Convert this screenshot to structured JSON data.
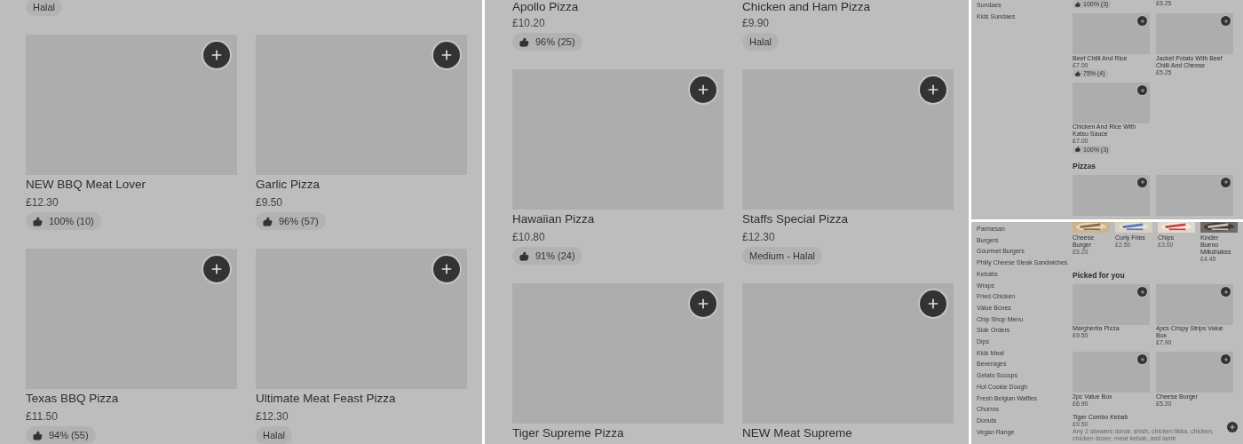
{
  "panels": [
    {
      "kind": "grid",
      "rows": [
        [
          {
            "kind": "tail",
            "badge": {
              "kind": "label",
              "text": "Halal"
            }
          }
        ],
        [
          {
            "kind": "card",
            "title": "NEW BBQ Meat Lover",
            "price": "£12.30",
            "badge": {
              "kind": "rating",
              "text": "100% (10)"
            }
          },
          {
            "kind": "card",
            "title": "Garlic Pizza",
            "price": "£9.50",
            "badge": {
              "kind": "rating",
              "text": "96% (57)"
            }
          }
        ],
        [
          {
            "kind": "card",
            "title": "Texas BBQ Pizza",
            "price": "£11.50",
            "badge": {
              "kind": "rating",
              "text": "94% (55)"
            }
          },
          {
            "kind": "card",
            "title": "Ultimate Meat Feast Pizza",
            "price": "£12.30",
            "badge": {
              "kind": "label",
              "text": "Halal"
            }
          }
        ]
      ]
    },
    {
      "kind": "grid",
      "rows": [
        [
          {
            "kind": "tail",
            "title": "Apollo Pizza",
            "price": "£10.20",
            "badge": {
              "kind": "rating",
              "text": "96% (25)"
            }
          },
          {
            "kind": "tail",
            "title": "Chicken and Ham Pizza",
            "price": "£9.90",
            "badge": {
              "kind": "label",
              "text": "Halal"
            }
          }
        ],
        [
          {
            "kind": "card",
            "title": "Hawaiian Pizza",
            "price": "£10.80",
            "badge": {
              "kind": "rating",
              "text": "91% (24)"
            }
          },
          {
            "kind": "card",
            "title": "Staffs Special Pizza",
            "price": "£12.30",
            "badge": {
              "kind": "label",
              "text": "Medium - Halal"
            }
          }
        ],
        [
          {
            "kind": "card",
            "title": "Tiger Supreme Pizza"
          },
          {
            "kind": "card",
            "title": "NEW Meat Supreme"
          }
        ]
      ]
    },
    {
      "kind": "menu",
      "sidebar": [
        "Sundaes",
        "Kids Sundaes"
      ],
      "sections": [
        {
          "kind": "grid",
          "rows": [
            [
              {
                "kind": "tail",
                "badge": {
                  "kind": "rating",
                  "text": "100% (3)"
                }
              },
              {
                "kind": "tail",
                "price": "£5.25"
              }
            ],
            [
              {
                "kind": "card",
                "title": "Beef Chilli And Rice",
                "price": "£7.00",
                "badge": {
                  "kind": "rating",
                  "text": "75% (4)"
                }
              },
              {
                "kind": "card",
                "title": "Jacket Potato With Beef Chilli And Cheese",
                "price": "£5.25"
              }
            ],
            [
              {
                "kind": "card",
                "title": "Chicken And Rice With Katsu Sauce",
                "price": "£7.00",
                "badge": {
                  "kind": "rating",
                  "text": "100% (3)"
                }
              }
            ]
          ]
        },
        {
          "kind": "grid",
          "heading": "Pizzas",
          "rows": [
            [
              {
                "kind": "card"
              },
              {
                "kind": "card"
              }
            ]
          ]
        }
      ]
    },
    {
      "kind": "menu",
      "sidebar": [
        "Parmesan",
        "Burgers",
        "Gourmet Burgers",
        "Philly Cheese Steak Sandwiches",
        "Kebabs",
        "Wraps",
        "Fried Chicken",
        "Value Boxes",
        "Chip Shop Menu",
        "Side Orders",
        "Dips",
        "Kids Meal",
        "Beverages",
        "Gelato Scoops",
        "Hot Cookie Dough",
        "Fresh Belgian Waffles",
        "Churros",
        "Donuts",
        "Vegan Range"
      ],
      "sections": [
        {
          "kind": "carousel",
          "items": [
            {
              "title": "Cheese Burger",
              "price": "£5.20"
            },
            {
              "title": "Curly Fries",
              "price": "£2.50"
            },
            {
              "title": "Chips",
              "price": "£3.00"
            },
            {
              "title": "Kinder Bueno Milkshakes",
              "price": "£4.45"
            }
          ]
        },
        {
          "kind": "grid",
          "heading": "Picked for you",
          "rows": [
            [
              {
                "kind": "card",
                "title": "Margherita Pizza",
                "price": "£9.50"
              },
              {
                "kind": "card",
                "title": "4pcs Crispy Strips Value Box",
                "price": "£7.90"
              }
            ],
            [
              {
                "kind": "card",
                "title": "2pc Value Box",
                "price": "£6.90"
              },
              {
                "kind": "card",
                "title": "Cheese Burger",
                "price": "£5.20"
              }
            ]
          ]
        },
        {
          "kind": "list",
          "items": [
            {
              "title": "Tiger Combo Kebab",
              "price": "£9.50",
              "description": "Any 2 skewers donar, shish, chicken tikka, chicken, chicken doner, meat kebab, and lamb"
            }
          ]
        }
      ]
    }
  ]
}
